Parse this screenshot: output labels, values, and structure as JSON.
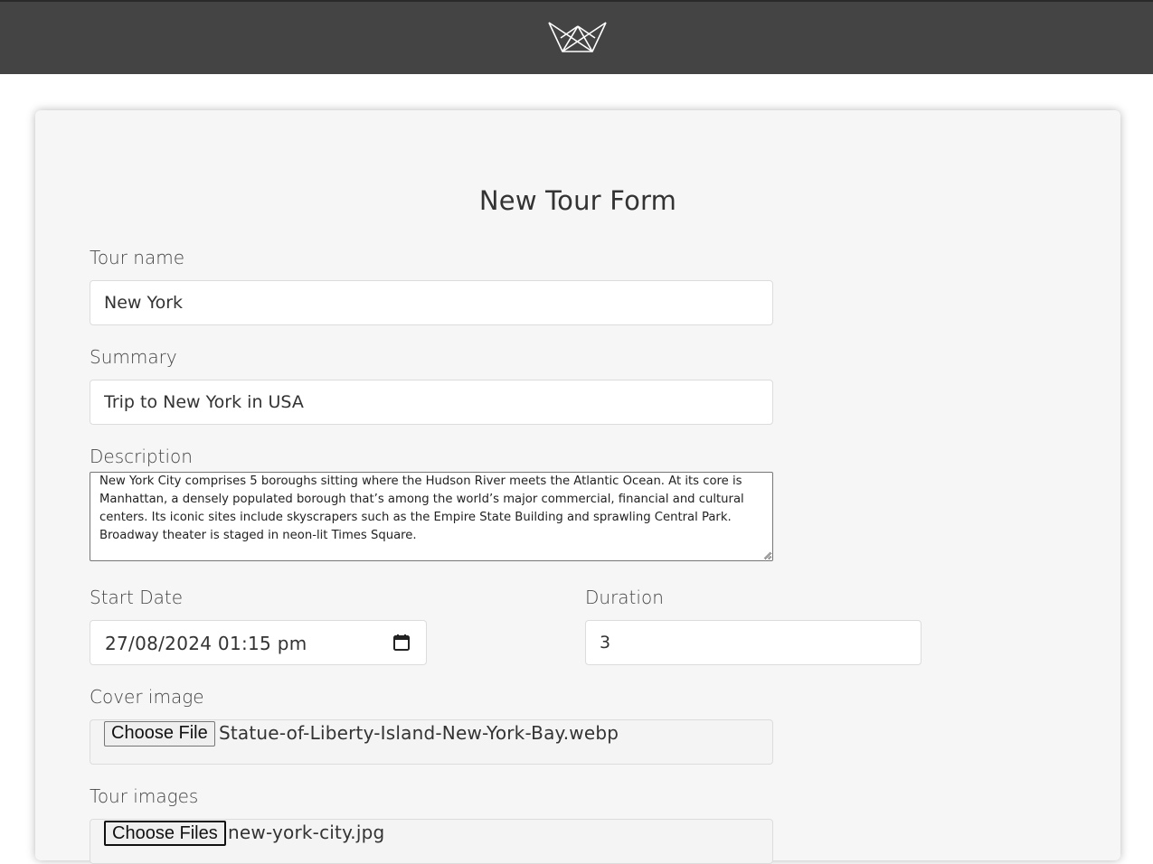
{
  "header": {
    "logo_icon": "crown-logo-icon",
    "background": "#444444"
  },
  "form": {
    "title": "New Tour Form",
    "tour_name": {
      "label": "Tour name",
      "value": "New York"
    },
    "summary": {
      "label": "Summary",
      "value": "Trip to New York in USA"
    },
    "description": {
      "label": "Description",
      "value": "New York City comprises 5 boroughs sitting where the Hudson River meets the Atlantic Ocean. At its core is Manhattan, a densely populated borough that’s among the world’s major commercial, financial and cultural centers. Its iconic sites include skyscrapers such as the Empire State Building and sprawling Central Park. Broadway theater is staged in neon-lit Times Square."
    },
    "start_date": {
      "label": "Start Date",
      "value": "27/08/2024 01:15 pm",
      "icon": "calendar-icon"
    },
    "duration": {
      "label": "Duration",
      "value": "3"
    },
    "cover_image": {
      "label": "Cover image",
      "button_label": "Choose File",
      "file_name": "Statue-of-Liberty-Island-New-York-Bay.webp"
    },
    "tour_images": {
      "label": "Tour images",
      "button_label": "Choose Files",
      "file_name": "new-york-city.jpg"
    }
  }
}
